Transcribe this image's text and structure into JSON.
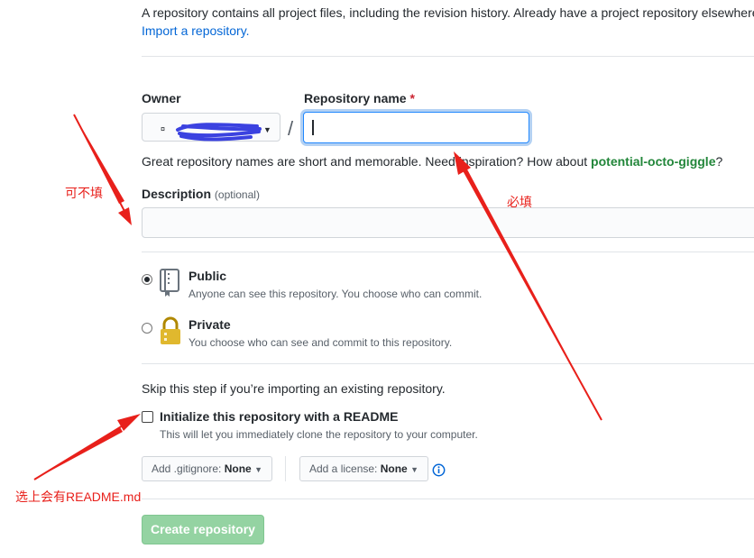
{
  "intro": {
    "text": "A repository contains all project files, including the revision history. Already have a project repository elsewhere",
    "import_link": "Import a repository."
  },
  "owner": {
    "label": "Owner",
    "value": "¤"
  },
  "repo_name": {
    "label": "Repository name",
    "required_mark": "*",
    "value": ""
  },
  "separator": "/",
  "hint": {
    "text": "Great repository names are short and memorable. Need inspiration? How about ",
    "suggestion": "potential-octo-giggle",
    "end": "?"
  },
  "description": {
    "label": "Description",
    "optional": "(optional)",
    "value": ""
  },
  "visibility": [
    {
      "title": "Public",
      "note": "Anyone can see this repository. You choose who can commit.",
      "selected": true
    },
    {
      "title": "Private",
      "note": "You choose who can see and commit to this repository.",
      "selected": false
    }
  ],
  "init": {
    "skip_text": "Skip this step if you’re importing an existing repository.",
    "readme_label": "Initialize this repository with a README",
    "readme_note": "This will let you immediately clone the repository to your computer.",
    "gitignore_label": "Add .gitignore:",
    "gitignore_value": "None",
    "license_label": "Add a license:",
    "license_value": "None"
  },
  "create_button": "Create repository",
  "annotations": {
    "optional_note": "可不填",
    "required_note": "必填",
    "readme_note": "选上会有README.md"
  },
  "colors": {
    "link": "#0366d6",
    "suggestion": "#22863a",
    "annotation": "#e8201b",
    "create_button": "#94d3a2"
  },
  "icons": [
    "repo-icon",
    "lock-icon",
    "info-icon",
    "caret-down-icon"
  ]
}
